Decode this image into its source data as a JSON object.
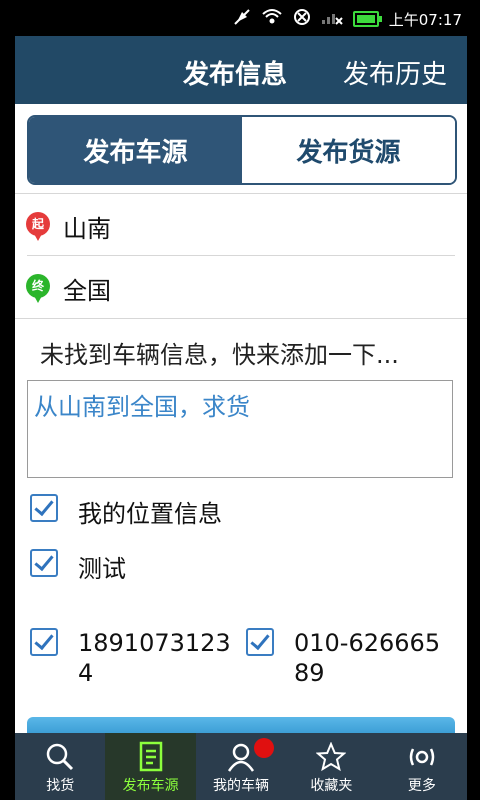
{
  "status_bar": {
    "time": "上午07:17"
  },
  "header": {
    "title": "发布信息",
    "history_button": "发布历史",
    "background": "#224966"
  },
  "segment": {
    "tabs": [
      "发布车源",
      "发布货源"
    ],
    "active_index": 0
  },
  "locations": {
    "origin_icon": "起",
    "origin": "山南",
    "destination_icon": "终",
    "destination": "全国"
  },
  "notice": "未找到车辆信息，快来添加一下...",
  "message_input": {
    "value": "从山南到全国，求货"
  },
  "options": [
    {
      "label": "我的位置信息",
      "checked": true
    },
    {
      "label": "测试",
      "checked": true
    }
  ],
  "phones": [
    {
      "line1": "1891073123",
      "line2": "4",
      "checked": true
    },
    {
      "line1": "010-626665",
      "line2": "89",
      "checked": true
    }
  ],
  "bottom_tabs": [
    {
      "label": "找货",
      "icon": "search-icon"
    },
    {
      "label": "发布车源",
      "icon": "publish-icon",
      "active": true
    },
    {
      "label": "我的车辆",
      "icon": "person-icon"
    },
    {
      "label": "收藏夹",
      "icon": "star-icon"
    },
    {
      "label": "更多",
      "icon": "more-icon"
    }
  ]
}
